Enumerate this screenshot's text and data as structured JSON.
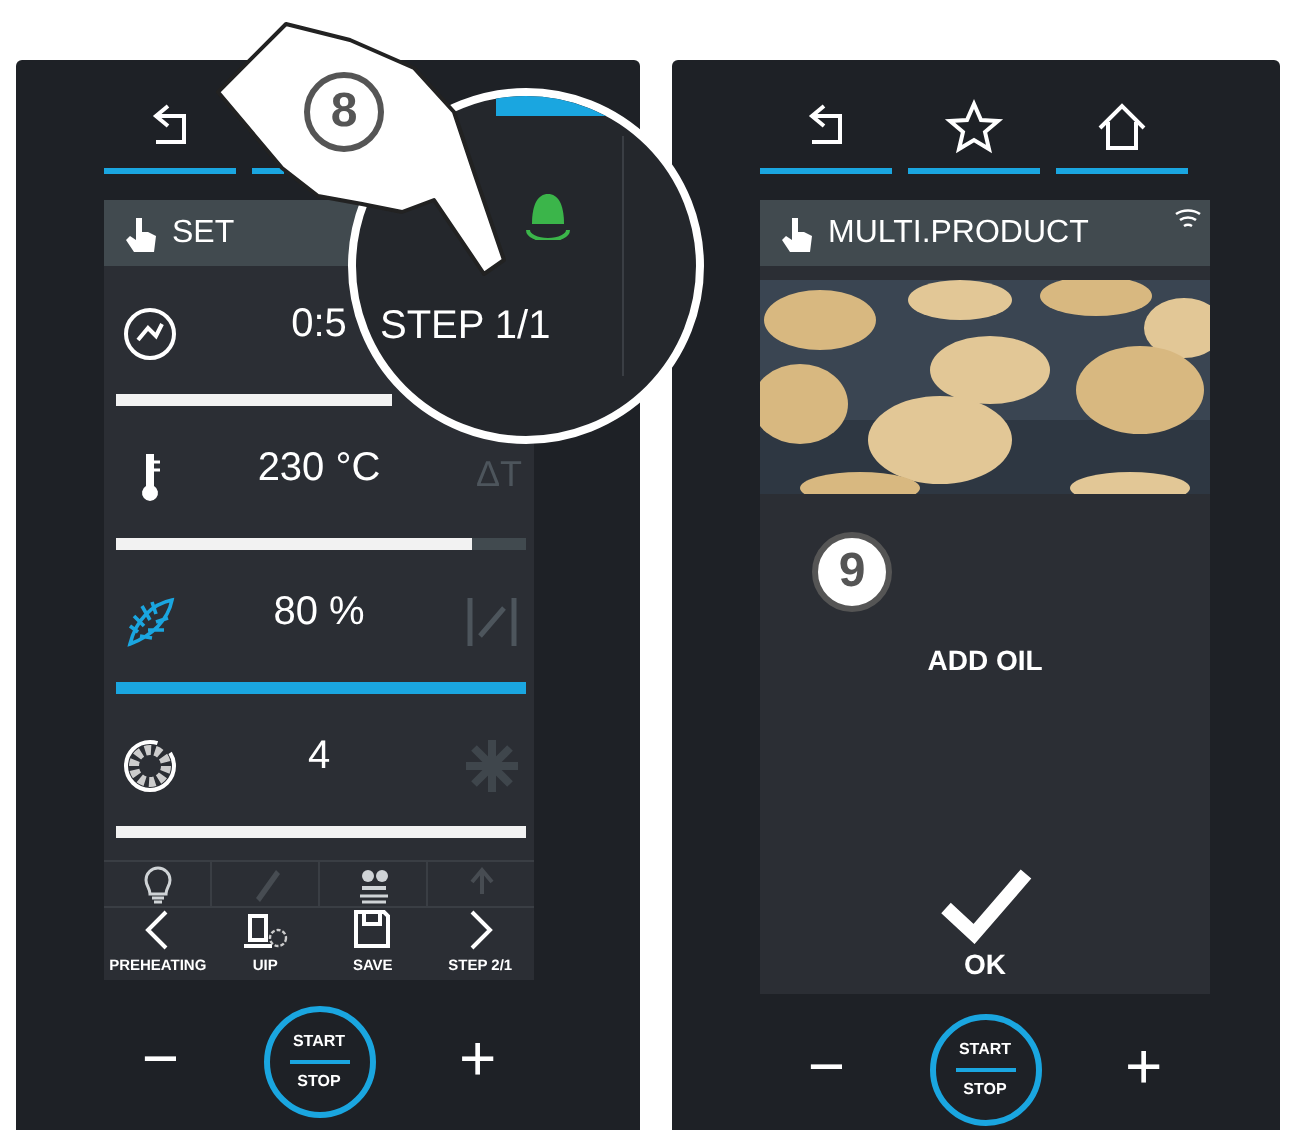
{
  "left_screen": {
    "tabs": [
      {
        "kind": "back"
      }
    ],
    "header": {
      "title": "SET"
    },
    "parameters": [
      {
        "kind": "time",
        "value": "0:5",
        "color": "#f2f2f2"
      },
      {
        "kind": "temperature",
        "value": "230 °C",
        "level": 0.87,
        "color": "#f2f2f2",
        "side_text": "ΔT"
      },
      {
        "kind": "humidity",
        "value": "80 %",
        "level": 1,
        "color": "#1aa6e0"
      },
      {
        "kind": "fan",
        "value": "4",
        "level": 1,
        "color": "#f2f2f2"
      }
    ],
    "tools": [
      {
        "kind": "bulb",
        "disabled": false
      },
      {
        "kind": "pencil",
        "disabled": true
      },
      {
        "kind": "tray",
        "disabled": false
      },
      {
        "kind": "arrow",
        "disabled": true
      }
    ],
    "actions": [
      {
        "kind": "prev",
        "label": "PREHEATING"
      },
      {
        "kind": "probe",
        "label": "UIP"
      },
      {
        "kind": "save",
        "label": "SAVE"
      },
      {
        "kind": "next",
        "label": "STEP 2/1"
      }
    ],
    "controls": {
      "minus": "−",
      "start": "START",
      "stop": "STOP",
      "plus": "+"
    },
    "callout": "8",
    "magnifier": {
      "text": "STEP 1/1"
    }
  },
  "right_screen": {
    "tabs": [
      {
        "kind": "back"
      },
      {
        "kind": "star"
      },
      {
        "kind": "home"
      }
    ],
    "header": {
      "title": "MULTI.PRODUCT",
      "wifi": true
    },
    "callout": "9",
    "message": "ADD OIL",
    "confirm": "OK",
    "controls": {
      "minus": "−",
      "start": "START",
      "stop": "STOP",
      "plus": "+"
    }
  }
}
